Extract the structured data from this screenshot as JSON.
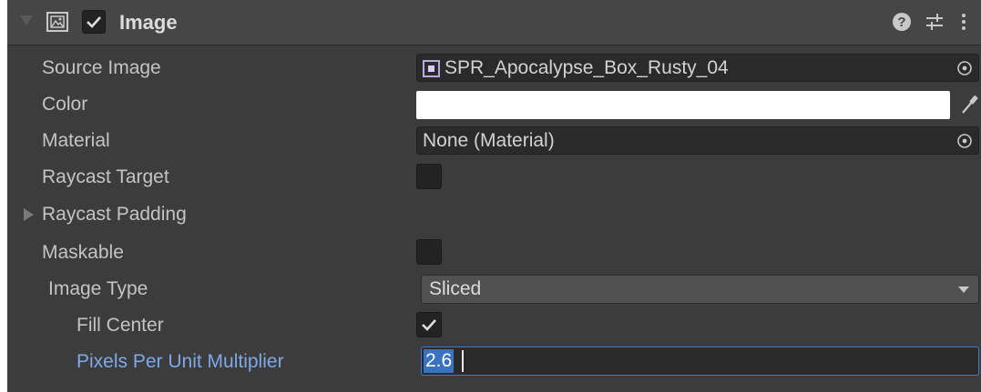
{
  "component": {
    "title": "Image",
    "enabled": true,
    "icons": {
      "fold": "triangle-down-icon",
      "component": "image-component-icon",
      "help": "help-icon",
      "presets": "presets-icon",
      "menu": "kebab-menu-icon"
    }
  },
  "properties": {
    "source_image": {
      "label": "Source Image",
      "value": "SPR_Apocalypse_Box_Rusty_04",
      "icon": "sprite-icon"
    },
    "color": {
      "label": "Color",
      "value": "#ffffff"
    },
    "material": {
      "label": "Material",
      "value": "None (Material)"
    },
    "raycast_target": {
      "label": "Raycast Target",
      "checked": false
    },
    "raycast_padding": {
      "label": "Raycast Padding",
      "expanded": false
    },
    "maskable": {
      "label": "Maskable",
      "checked": false
    },
    "image_type": {
      "label": "Image Type",
      "value": "Sliced"
    },
    "fill_center": {
      "label": "Fill Center",
      "checked": true
    },
    "pixels_per_unit_multiplier": {
      "label": "Pixels Per Unit Multiplier",
      "value": "2.6"
    }
  },
  "colors": {
    "panel_bg": "#3c3c3c",
    "header_bg": "#464646",
    "field_bg": "#2a2a2a",
    "highlight_label": "#7fa8e8",
    "focus_border": "#3d7ed4"
  }
}
